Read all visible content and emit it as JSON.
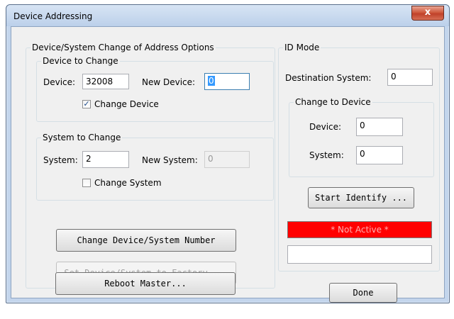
{
  "window": {
    "title": "Device Addressing",
    "close_glyph": "x"
  },
  "address_options": {
    "legend": "Device/System Change of Address Options",
    "device_group": {
      "legend": "Device to Change",
      "device_label": "Device:",
      "device_value": "32008",
      "new_device_label": "New Device:",
      "new_device_value": "0",
      "change_device_checked": true,
      "change_device_label": "Change Device"
    },
    "system_group": {
      "legend": "System to Change",
      "system_label": "System:",
      "system_value": "2",
      "new_system_label": "New System:",
      "new_system_value": "0",
      "change_system_checked": false,
      "change_system_label": "Change System"
    },
    "buttons": {
      "change_number": "Change Device/System Number",
      "set_factory": "Set Device/System to Factory ...",
      "reboot": "Reboot Master..."
    }
  },
  "id_mode": {
    "legend": "ID Mode",
    "destination_label": "Destination System:",
    "destination_value": "0",
    "change_group": {
      "legend": "Change to Device",
      "device_label": "Device:",
      "device_value": "0",
      "system_label": "System:",
      "system_value": "0"
    },
    "start_identify": "Start Identify ...",
    "status_text": "* Not Active *",
    "status_color": "#ff0000",
    "info_value": ""
  },
  "done_button": "Done"
}
